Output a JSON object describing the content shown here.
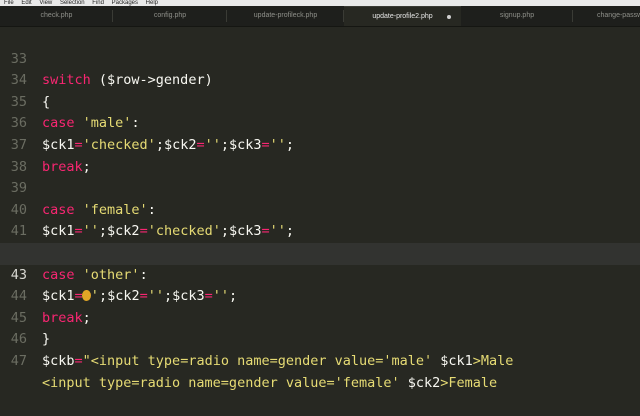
{
  "menubar": {
    "items": [
      "File",
      "Edit",
      "View",
      "Selection",
      "Find",
      "Packages",
      "Help"
    ]
  },
  "tabs": [
    {
      "label": "check.php",
      "active": false
    },
    {
      "label": "config.php",
      "active": false
    },
    {
      "label": "update-profileck.php",
      "active": false
    },
    {
      "label": "update-profile2.php",
      "active": true
    },
    {
      "label": "signup.php",
      "active": false
    },
    {
      "label": "change-passw",
      "active": false
    }
  ],
  "editor": {
    "lines": [
      {
        "num": "33",
        "code": "switch ($row->gender)"
      },
      {
        "num": "34",
        "code": "{"
      },
      {
        "num": "35",
        "code": "case 'male':"
      },
      {
        "num": "36",
        "code": "$ck1='checked';$ck2='';$ck3='';"
      },
      {
        "num": "37",
        "code": "break;"
      },
      {
        "num": "38",
        "code": ""
      },
      {
        "num": "39",
        "code": "case 'female':"
      },
      {
        "num": "40",
        "code": "$ck1='';$ck2='checked';$ck3='';"
      },
      {
        "num": "41",
        "code": "break;"
      },
      {
        "num": "42",
        "code": "case 'other':"
      },
      {
        "num": "43",
        "code": "$ck1='';$ck2='';$ck3='';"
      },
      {
        "num": "44",
        "code": "break;"
      },
      {
        "num": "45",
        "code": "}"
      },
      {
        "num": "46",
        "code": "$ckb=\"<input type=radio name=gender value='male' $ck1>Male"
      },
      {
        "num": "47",
        "code": "<input type=radio name=gender value='female' $ck2>Female"
      }
    ],
    "current_line": "43"
  },
  "colors": {
    "background": "#272822",
    "keyword": "#f92672",
    "string": "#e6db74",
    "text": "#f8f8f2",
    "gutter": "#6b6d62"
  }
}
